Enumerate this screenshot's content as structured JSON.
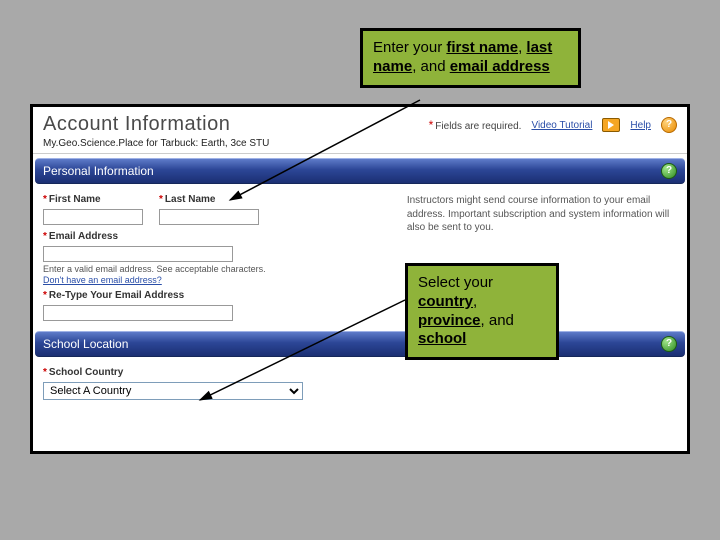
{
  "callouts": {
    "names_email_html": "Enter your <b>first name</b>, <b>last name</b>, and <b>email address</b>",
    "location_html": "Select your <b>country</b>, <b>province</b>, and <b>school</b>"
  },
  "header": {
    "title": "Account Information",
    "required_note": "Fields are required.",
    "video_tutorial": "Video Tutorial",
    "help": "Help",
    "product_line": "My.Geo.Science.Place for Tarbuck: Earth, 3ce STU"
  },
  "sections": {
    "personal": "Personal Information",
    "school": "School Location"
  },
  "fields": {
    "first_name": {
      "label": "First Name",
      "value": ""
    },
    "last_name": {
      "label": "Last Name",
      "value": ""
    },
    "email": {
      "label": "Email Address",
      "value": ""
    },
    "retype_email": {
      "label": "Re-Type Your Email Address",
      "value": ""
    },
    "school_country": {
      "label": "School Country",
      "selected": "Select A Country"
    }
  },
  "hints": {
    "email_hint": "Enter a valid email address. See acceptable characters.",
    "no_email_link": "Don't have an email address?",
    "side_note": "Instructors might send course information to your email address. Important subscription and system information will also be sent to you."
  }
}
